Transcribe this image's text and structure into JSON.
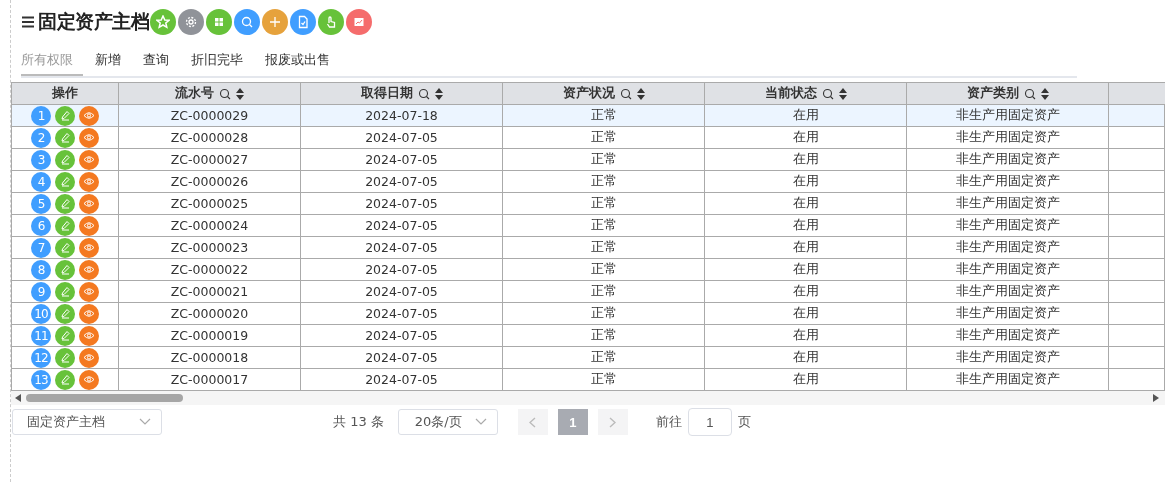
{
  "title": "固定资产主档",
  "tabs": [
    {
      "label": "所有权限",
      "selected": true
    },
    {
      "label": "新增",
      "selected": false
    },
    {
      "label": "查询",
      "selected": false
    },
    {
      "label": "折旧完毕",
      "selected": false
    },
    {
      "label": "报废或出售",
      "selected": false
    }
  ],
  "table": {
    "columns": [
      {
        "label": "操作",
        "sortable": false
      },
      {
        "label": "流水号",
        "sortable": true
      },
      {
        "label": "取得日期",
        "sortable": true
      },
      {
        "label": "资产状况",
        "sortable": true
      },
      {
        "label": "当前状态",
        "sortable": true
      },
      {
        "label": "资产类别",
        "sortable": true
      }
    ],
    "rows": [
      {
        "cells": [
          "1",
          "ZC-0000029",
          "2024-07-18",
          "正常",
          "在用",
          "非生产用固定资产"
        ],
        "selected": true
      },
      {
        "cells": [
          "2",
          "ZC-0000028",
          "2024-07-05",
          "正常",
          "在用",
          "非生产用固定资产"
        ],
        "selected": false
      },
      {
        "cells": [
          "3",
          "ZC-0000027",
          "2024-07-05",
          "正常",
          "在用",
          "非生产用固定资产"
        ],
        "selected": false
      },
      {
        "cells": [
          "4",
          "ZC-0000026",
          "2024-07-05",
          "正常",
          "在用",
          "非生产用固定资产"
        ],
        "selected": false
      },
      {
        "cells": [
          "5",
          "ZC-0000025",
          "2024-07-05",
          "正常",
          "在用",
          "非生产用固定资产"
        ],
        "selected": false
      },
      {
        "cells": [
          "6",
          "ZC-0000024",
          "2024-07-05",
          "正常",
          "在用",
          "非生产用固定资产"
        ],
        "selected": false
      },
      {
        "cells": [
          "7",
          "ZC-0000023",
          "2024-07-05",
          "正常",
          "在用",
          "非生产用固定资产"
        ],
        "selected": false
      },
      {
        "cells": [
          "8",
          "ZC-0000022",
          "2024-07-05",
          "正常",
          "在用",
          "非生产用固定资产"
        ],
        "selected": false
      },
      {
        "cells": [
          "9",
          "ZC-0000021",
          "2024-07-05",
          "正常",
          "在用",
          "非生产用固定资产"
        ],
        "selected": false
      },
      {
        "cells": [
          "10",
          "ZC-0000020",
          "2024-07-05",
          "正常",
          "在用",
          "非生产用固定资产"
        ],
        "selected": false
      },
      {
        "cells": [
          "11",
          "ZC-0000019",
          "2024-07-05",
          "正常",
          "在用",
          "非生产用固定资产"
        ],
        "selected": false
      },
      {
        "cells": [
          "12",
          "ZC-0000018",
          "2024-07-05",
          "正常",
          "在用",
          "非生产用固定资产"
        ],
        "selected": false
      },
      {
        "cells": [
          "13",
          "ZC-0000017",
          "2024-07-05",
          "正常",
          "在用",
          "非生产用固定资产"
        ],
        "selected": false
      }
    ]
  },
  "footer": {
    "view_select": "固定资产主档",
    "total": "共 13 条",
    "page_size": "20条/页",
    "current_page": "1",
    "goto_label": "前往",
    "goto_value": "1",
    "page_suffix": "页"
  }
}
